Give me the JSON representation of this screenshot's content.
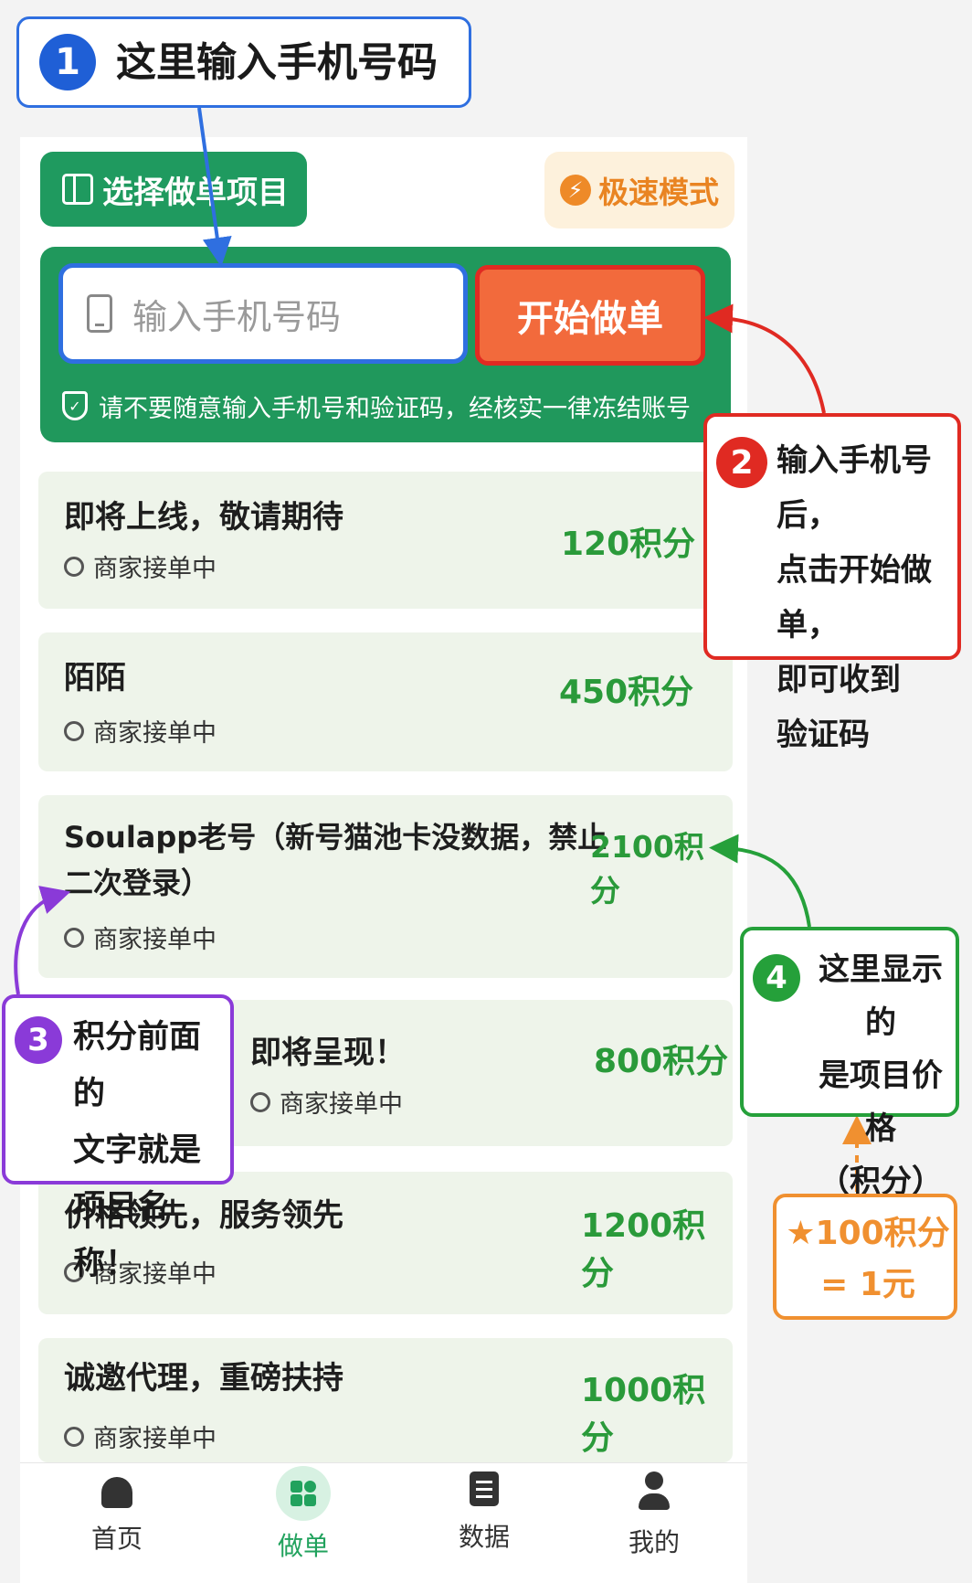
{
  "header": {
    "select_project_label": "选择做单项目",
    "speed_mode_label": "极速模式"
  },
  "order_form": {
    "phone_placeholder": "输入手机号码",
    "start_button_label": "开始做单",
    "warning_text": "请不要随意输入手机号和验证码，经核实一律冻结账号"
  },
  "projects": [
    {
      "name": "即将上线，敬请期待",
      "status": "商家接单中",
      "points": "120积分"
    },
    {
      "name": "陌陌",
      "status": "商家接单中",
      "points": "450积分"
    },
    {
      "name_line1": "Soulapp老号（新号猫池卡没数据，禁止",
      "name_line2": "二次登录）",
      "status": "商家接单中",
      "points": "2100积分"
    },
    {
      "name": "即将呈现！",
      "status": "商家接单中",
      "points": "800积分"
    },
    {
      "name": "价格领先，服务领先",
      "status": "商家接单中",
      "points": "1200积分"
    },
    {
      "name": "诚邀代理，重磅扶持",
      "status": "商家接单中",
      "points": "1000积分"
    }
  ],
  "tabs": [
    {
      "label": "首页",
      "icon": "home-icon"
    },
    {
      "label": "做单",
      "icon": "grid-icon",
      "active": true
    },
    {
      "label": "数据",
      "icon": "document-icon"
    },
    {
      "label": "我的",
      "icon": "user-icon"
    }
  ],
  "annotations": {
    "step1": {
      "number": "1",
      "text": "这里输入手机号码"
    },
    "step2": {
      "number": "2",
      "lines": [
        "输入手机号后，",
        "点击开始做单，",
        "即可收到",
        "验证码"
      ]
    },
    "step3": {
      "number": "3",
      "lines": [
        "积分前面的",
        "文字就是",
        "项目名称！"
      ]
    },
    "step4": {
      "number": "4",
      "lines": [
        "这里显示的",
        "是项目价格",
        "（积分）"
      ]
    },
    "rate": {
      "line1": "★100积分",
      "line2": "= 1元"
    }
  },
  "colors": {
    "primary_green": "#20985c",
    "start_red": "#f26a3c",
    "points_green": "#2a9a3a",
    "step1_blue": "#2f6fe0",
    "step2_red": "#e02a22",
    "step3_purple": "#8a3ad8",
    "step4_green": "#25a03a",
    "rate_orange": "#f09030"
  }
}
